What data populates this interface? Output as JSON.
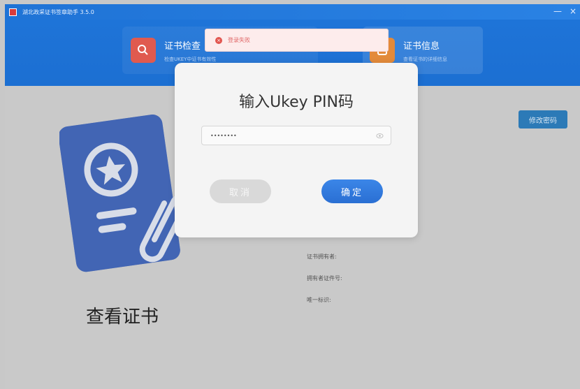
{
  "window": {
    "title": "湖北政采证书签章助手 3.5.0",
    "minimize_glyph": "—",
    "close_glyph": "×"
  },
  "header": {
    "cards": [
      {
        "title": "证书检查",
        "subtitle": "检查UKEY中证书有效性",
        "icon": "search-doc-icon",
        "color": "#e05a4f"
      },
      {
        "title": "证书信息",
        "subtitle": "查看证书的详细信息",
        "icon": "cert-info-icon",
        "color": "#e38a3a"
      }
    ]
  },
  "toast": {
    "icon": "error-icon",
    "text": "登录失败"
  },
  "main": {
    "view_title": "查看证书",
    "change_password_label": "修改密码",
    "info_labels": [
      "证书拥有者:",
      "拥有者证件号:",
      "唯一标识:"
    ]
  },
  "modal": {
    "title": "输入Ukey PIN码",
    "pin_value": "••••••••",
    "cancel_label": "取消",
    "ok_label": "确定"
  },
  "colors": {
    "accent": "#1e74d8",
    "ok_button": "#2a6fd3",
    "error": "#e2554f"
  }
}
